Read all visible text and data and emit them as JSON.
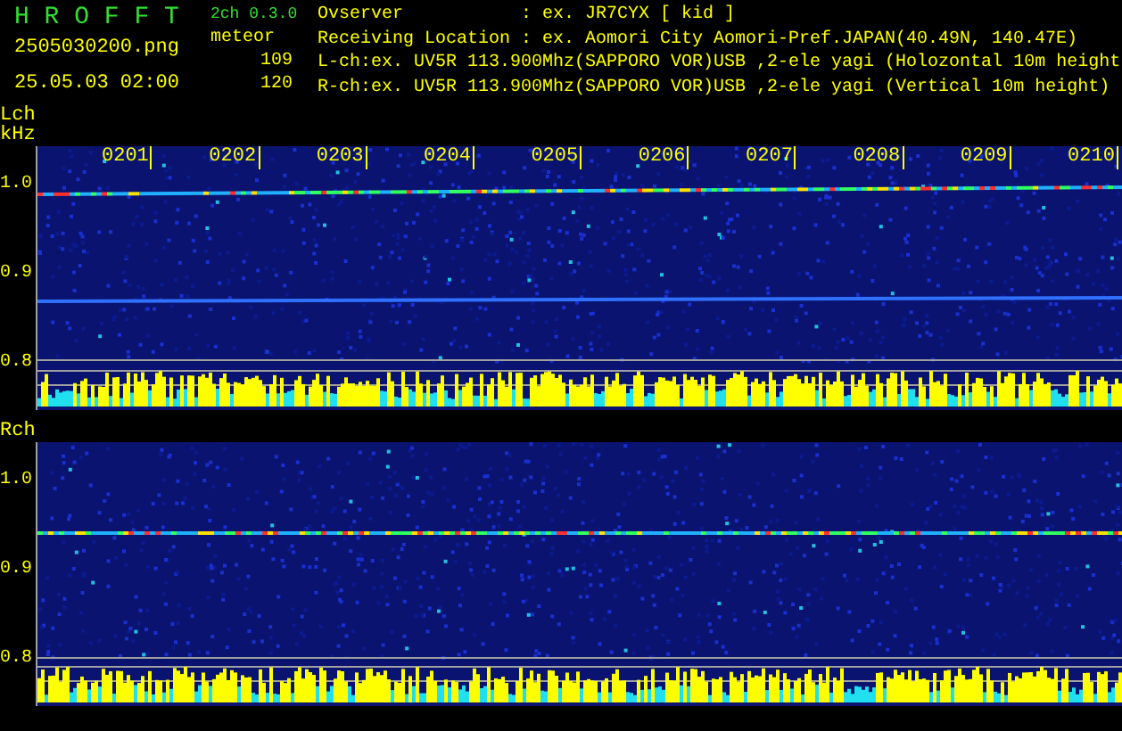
{
  "header": {
    "app_name": "H R O F F T",
    "version": "2ch 0.3.0",
    "filename": "2505030200.png",
    "timestamp": "25.05.03 02:00",
    "meteor_label": "meteor",
    "counts": [
      "109",
      "120"
    ],
    "info": [
      {
        "label": "Ovserver",
        "value": ": ex. JR7CYX [ kid ]"
      },
      {
        "label": "Receiving Location",
        "value": ": ex. Aomori City Aomori-Pref.JAPAN(40.49N, 140.47E)"
      }
    ],
    "channel_lines": [
      "L-ch:ex. UV5R 113.900Mhz(SAPPORO VOR)USB ,2-ele yagi (Holozontal 10m height",
      "R-ch:ex. UV5R 113.900Mhz(SAPPORO VOR)USB ,2-ele yagi (Vertical 10m height)"
    ]
  },
  "channels": [
    {
      "name": "Lch",
      "unit": "kHz",
      "y_labels": [
        "1.0",
        "0.9",
        "0.8"
      ],
      "time_labels": [
        "0201",
        "0202",
        "0203",
        "0204",
        "0205",
        "0206",
        "0207",
        "0208",
        "0209",
        "0210"
      ]
    },
    {
      "name": "Rch",
      "y_labels": [
        "1.0",
        "0.9",
        "0.8"
      ]
    }
  ]
}
